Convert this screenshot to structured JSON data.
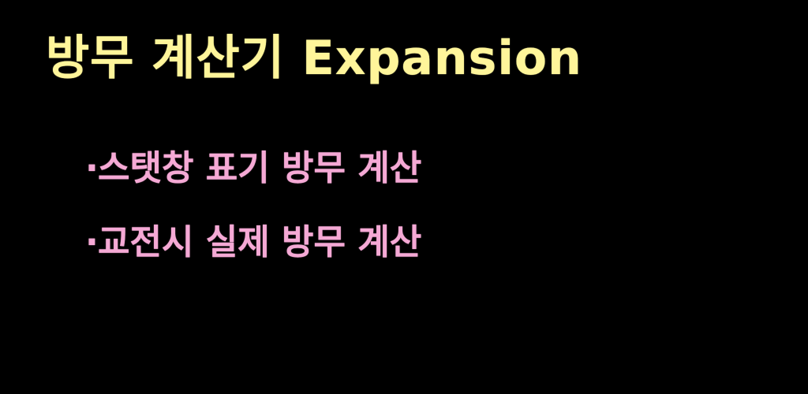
{
  "colors": {
    "background": "#000000",
    "title": "#FFF59A",
    "feature": "#F5A9D5"
  },
  "title": "방무 계산기 Expansion",
  "features": [
    {
      "bullet": "·",
      "text": "스탯창 표기 방무 계산"
    },
    {
      "bullet": "·",
      "text": "교전시 실제 방무 계산"
    }
  ]
}
